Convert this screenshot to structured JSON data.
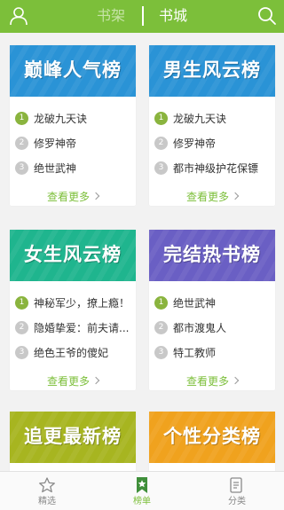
{
  "header": {
    "tab_shelf": "书架",
    "tab_store": "书城",
    "user_icon": "user-icon",
    "search_icon": "search-icon"
  },
  "colors": {
    "brand_green": "#7cbf3a",
    "banner_blue": "#2a93d6",
    "banner_teal": "#1fb58e",
    "banner_purple": "#6a5fc4",
    "banner_olive": "#a7b520",
    "banner_orange": "#f0a21e"
  },
  "cards": [
    {
      "title": "巅峰人气榜",
      "items": [
        {
          "rank": "1",
          "name": "龙破九天诀"
        },
        {
          "rank": "2",
          "name": "修罗神帝"
        },
        {
          "rank": "3",
          "name": "绝世武神"
        }
      ],
      "more": "查看更多"
    },
    {
      "title": "男生风云榜",
      "items": [
        {
          "rank": "1",
          "name": "龙破九天诀"
        },
        {
          "rank": "2",
          "name": "修罗神帝"
        },
        {
          "rank": "3",
          "name": "都市神级护花保镖"
        }
      ],
      "more": "查看更多"
    },
    {
      "title": "女生风云榜",
      "items": [
        {
          "rank": "1",
          "name": "神秘军少，撩上瘾！"
        },
        {
          "rank": "2",
          "name": "隐婚挚爱：前夫请..."
        },
        {
          "rank": "3",
          "name": "绝色王爷的傻妃"
        }
      ],
      "more": "查看更多"
    },
    {
      "title": "完结热书榜",
      "items": [
        {
          "rank": "1",
          "name": "绝世武神"
        },
        {
          "rank": "2",
          "name": "都市渡鬼人"
        },
        {
          "rank": "3",
          "name": "特工教师"
        }
      ],
      "more": "查看更多"
    },
    {
      "title": "追更最新榜"
    },
    {
      "title": "个性分类榜"
    }
  ],
  "nav": {
    "items": [
      {
        "label": "精选",
        "icon": "star-outline-icon"
      },
      {
        "label": "榜单",
        "icon": "ranking-bookmark-icon"
      },
      {
        "label": "分类",
        "icon": "category-document-icon"
      }
    ]
  }
}
